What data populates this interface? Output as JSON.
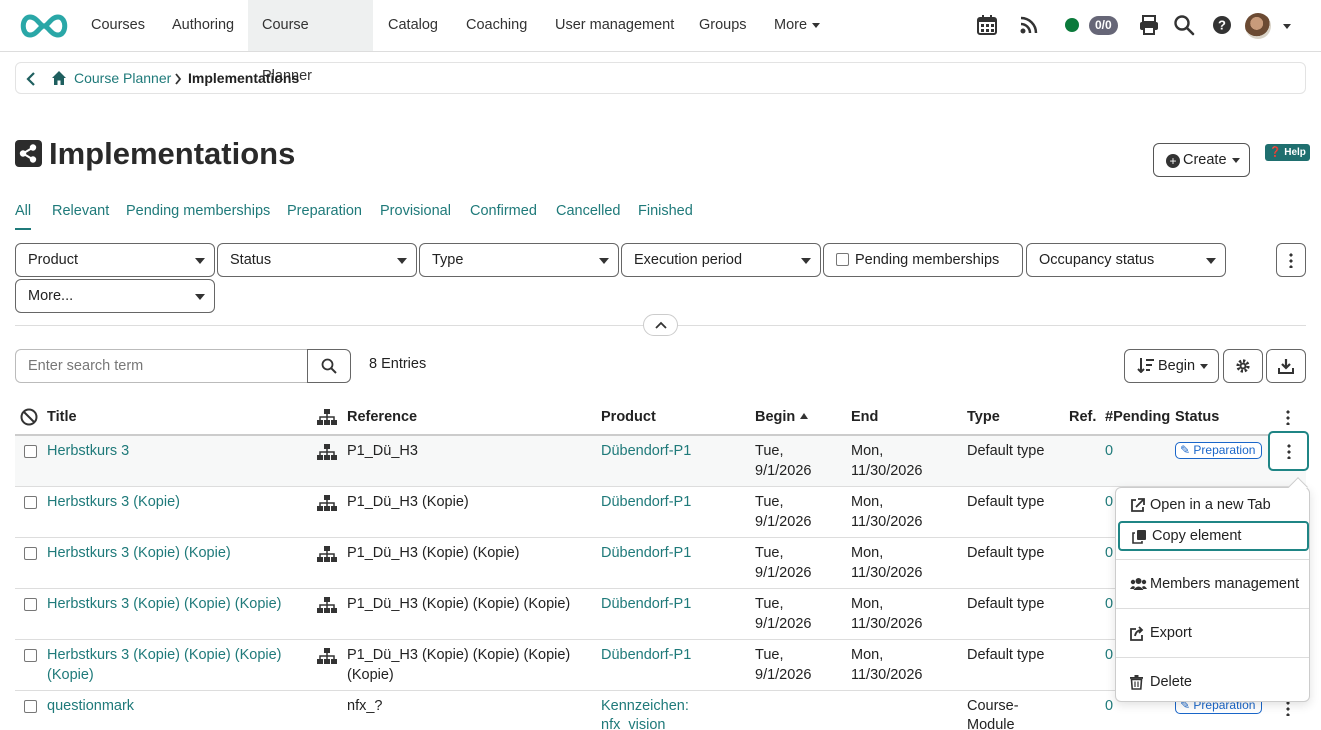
{
  "nav": {
    "items": [
      {
        "label": "Courses"
      },
      {
        "label": "Authoring"
      },
      {
        "label": "Course Planner"
      },
      {
        "label": "Catalog"
      },
      {
        "label": "Coaching"
      },
      {
        "label": "User management"
      },
      {
        "label": "Groups"
      },
      {
        "label": "More"
      }
    ],
    "active": "Course Planner",
    "badge": "0/0"
  },
  "breadcrumb": {
    "home": "Course Planner",
    "separator": "›",
    "current": "Implementations"
  },
  "page": {
    "title": "Implementations",
    "create_label": "Create",
    "help_label": "Help"
  },
  "tabs": [
    "All",
    "Relevant",
    "Pending memberships",
    "Preparation",
    "Provisional",
    "Confirmed",
    "Cancelled",
    "Finished"
  ],
  "filters": {
    "product": "Product",
    "status": "Status",
    "type": "Type",
    "execution_period": "Execution period",
    "pending_memberships": "Pending memberships",
    "occupancy_status": "Occupancy status",
    "more": "More..."
  },
  "search": {
    "placeholder": "Enter search term",
    "entries": "8 Entries",
    "sort_label": "Begin"
  },
  "table": {
    "headers": {
      "title": "Title",
      "reference": "Reference",
      "product": "Product",
      "begin": "Begin",
      "end": "End",
      "type": "Type",
      "ref": "Ref.",
      "pending": "#Pending",
      "status": "Status"
    },
    "rows": [
      {
        "title": "Herbstkurs 3",
        "reference": "P1_Dü_H3",
        "product": "Dübendorf-P1",
        "begin1": "Tue,",
        "begin2": "9/1/2026",
        "end1": "Mon,",
        "end2": "11/30/2026",
        "type": "Default type",
        "pending": "0",
        "status": "Preparation"
      },
      {
        "title": "Herbstkurs 3 (Kopie)",
        "reference": "P1_Dü_H3 (Kopie)",
        "product": "Dübendorf-P1",
        "begin1": "Tue,",
        "begin2": "9/1/2026",
        "end1": "Mon,",
        "end2": "11/30/2026",
        "type": "Default type",
        "pending": "0"
      },
      {
        "title": "Herbstkurs 3 (Kopie) (Kopie)",
        "reference": "P1_Dü_H3 (Kopie) (Kopie)",
        "product": "Dübendorf-P1",
        "begin1": "Tue,",
        "begin2": "9/1/2026",
        "end1": "Mon,",
        "end2": "11/30/2026",
        "type": "Default type",
        "pending": "0"
      },
      {
        "title": "Herbstkurs 3 (Kopie) (Kopie) (Kopie)",
        "reference": "P1_Dü_H3 (Kopie) (Kopie) (Kopie)",
        "product": "Dübendorf-P1",
        "begin1": "Tue,",
        "begin2": "9/1/2026",
        "end1": "Mon,",
        "end2": "11/30/2026",
        "type": "Default type",
        "pending": "0"
      },
      {
        "title1": "Herbstkurs 3 (Kopie) (Kopie) (Kopie)",
        "title2": "(Kopie)",
        "reference1": "P1_Dü_H3 (Kopie) (Kopie) (Kopie)",
        "reference2": "(Kopie)",
        "product": "Dübendorf-P1",
        "begin1": "Tue,",
        "begin2": "9/1/2026",
        "end1": "Mon,",
        "end2": "11/30/2026",
        "type": "Default type",
        "pending": "0"
      },
      {
        "title": "questionmark",
        "reference": "nfx_?",
        "product1": "Kennzeichen:",
        "product2": "nfx_vision",
        "type1": "Course-",
        "type2": "Module",
        "pending": "0",
        "status": "Preparation"
      }
    ]
  },
  "menu": {
    "open_new_tab": "Open in a new Tab",
    "copy_element": "Copy element",
    "members_management": "Members management",
    "export": "Export",
    "delete": "Delete"
  },
  "colors": {
    "accent": "#1f7a7a",
    "status_online": "#0b7a3b",
    "badge_blue": "#1a66c9"
  }
}
